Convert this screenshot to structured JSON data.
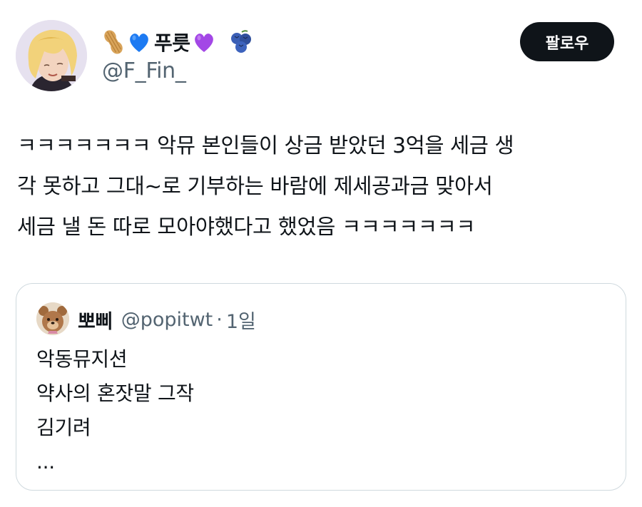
{
  "author": {
    "name": "푸릇",
    "handle": "@F_Fin_",
    "emojis": [
      "peanut-icon",
      "blue-heart-icon",
      "purple-heart-icon",
      "blueberries-icon"
    ]
  },
  "follow_button": {
    "label": "팔로우"
  },
  "tweet": {
    "lines": [
      "ㅋㅋㅋㅋㅋㅋㅋ 악뮤 본인들이 상금 받았던 3억을 세금 생",
      "각 못하고 그대~로 기부하는 바람에 제세공과금 맞아서",
      "세금 낼 돈 따로 모아야했다고 했었음 ㅋㅋㅋㅋㅋㅋㅋ"
    ]
  },
  "quote": {
    "name": "뽀삐",
    "handle": "@popitwt",
    "dot": "·",
    "time": "1일",
    "lines": [
      "악동뮤지션",
      "약사의 혼잣말 그작",
      "김기려",
      "..."
    ]
  },
  "colors": {
    "text_primary": "#0f1419",
    "text_secondary": "#536471",
    "border": "#cfd9de",
    "button_bg": "#0f1419",
    "blue_heart": "#1d7af2",
    "purple_heart": "#a347e6"
  }
}
